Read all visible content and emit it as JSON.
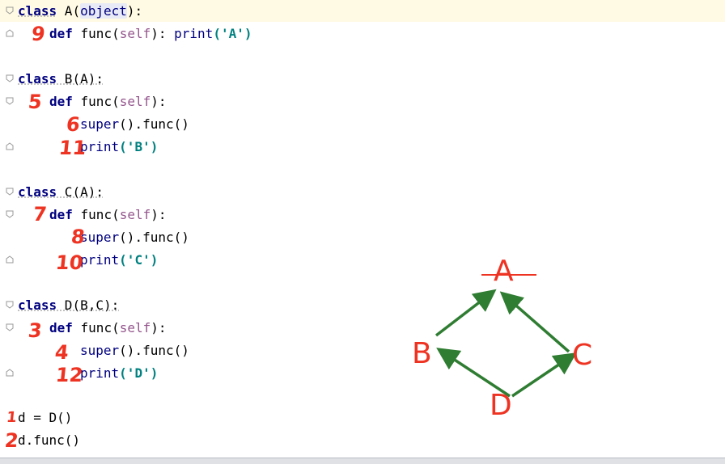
{
  "code": {
    "l1_class": "class",
    "l1_name": " A(",
    "l1_base": "object",
    "l1_end": "):",
    "l2_def": "def",
    "l2_rest": " func(",
    "l2_self": "self",
    "l2_mid": "): ",
    "l2_print": "print",
    "l2_str": "('A')",
    "l3_class": "class",
    "l3_rest": " B(A):",
    "l4_def": "def",
    "l4_rest": " func(",
    "l4_self": "self",
    "l4_end": "):",
    "l5_super": "super",
    "l5_rest": "().func()",
    "l6_print": "print",
    "l6_str": "('B')",
    "l7_class": "class",
    "l7_rest": " C(A):",
    "l8_def": "def",
    "l8_rest": " func(",
    "l8_self": "self",
    "l8_end": "):",
    "l9_super": "super",
    "l9_rest": "().func()",
    "l10_print": "print",
    "l10_str": "('C')",
    "l11_class": "class",
    "l11_rest": " D(B,C):",
    "l12_def": "def",
    "l12_rest": " func(",
    "l12_self": "self",
    "l12_end": "):",
    "l13_super": "super",
    "l13_rest": "().func()",
    "l14_print": "print",
    "l14_str": "('D')",
    "l15": "d = D()",
    "l16": "d.func()"
  },
  "annotations": {
    "a9": "9",
    "a5": "5",
    "a6": "6",
    "a11": "11",
    "a7": "7",
    "a8": "8",
    "a10": "10",
    "a3": "3",
    "a4": "4",
    "a12": "12",
    "a1": "1",
    "a2": "2"
  },
  "diagram": {
    "node_a": "A",
    "node_b": "B",
    "node_c": "C",
    "node_d": "D",
    "arrow_color": "#2f7d32",
    "label_color": "#ee3322"
  },
  "colors": {
    "keyword": "#000080",
    "self": "#94558d",
    "string": "#008080"
  }
}
